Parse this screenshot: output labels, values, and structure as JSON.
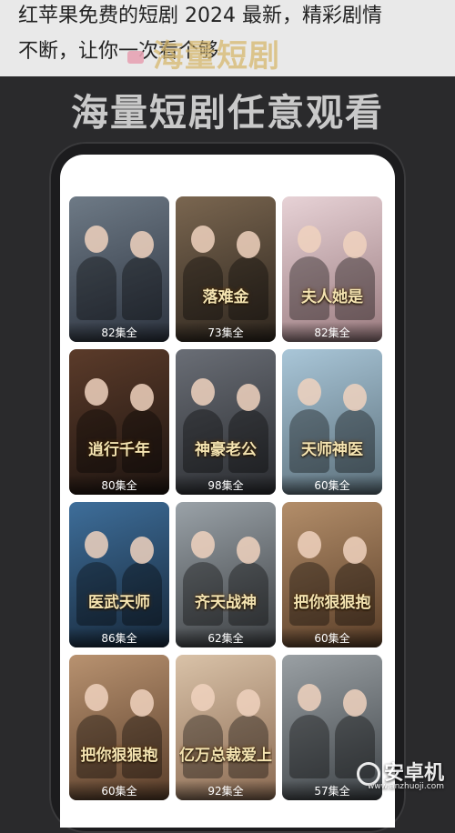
{
  "caption": {
    "line1": "红苹果免费的短剧 2024 最新，精彩剧情",
    "line2": "不断，让你一次看个够"
  },
  "overlay_brand": "海量短剧",
  "headline": "海量短剧任意观看",
  "dramas": [
    {
      "title_art": "",
      "episodes": "82集全",
      "colors": [
        "#6e7a86",
        "#2d3440"
      ]
    },
    {
      "title_art": "落难金",
      "episodes": "73集全",
      "colors": [
        "#7a6650",
        "#2e261e"
      ]
    },
    {
      "title_art": "夫人她是",
      "episodes": "82集全",
      "colors": [
        "#e7d2d6",
        "#9a7b7f"
      ]
    },
    {
      "title_art": "逍行千年",
      "episodes": "80集全",
      "colors": [
        "#5b3b2a",
        "#1d1410"
      ]
    },
    {
      "title_art": "神豪老公",
      "episodes": "98集全",
      "colors": [
        "#6a6e76",
        "#2a2c30"
      ]
    },
    {
      "title_art": "天师神医",
      "episodes": "60集全",
      "colors": [
        "#a9c6d8",
        "#5b6f7a"
      ]
    },
    {
      "title_art": "医武天师",
      "episodes": "86集全",
      "colors": [
        "#3e6e9a",
        "#17283a"
      ]
    },
    {
      "title_art": "齐天战神",
      "episodes": "62集全",
      "colors": [
        "#9aa2a8",
        "#3c3f42"
      ]
    },
    {
      "title_art": "把你狠狠抱",
      "episodes": "60集全",
      "colors": [
        "#b38e6a",
        "#5a3e28"
      ]
    },
    {
      "title_art": "把你狠狠抱",
      "episodes": "60集全",
      "colors": [
        "#b89270",
        "#5a3e2a"
      ]
    },
    {
      "title_art": "亿万总裁爱上我",
      "episodes": "92集全",
      "colors": [
        "#d9c2a8",
        "#8a6a52"
      ]
    },
    {
      "title_art": "",
      "episodes": "57集全",
      "colors": [
        "#9aa0a4",
        "#3f4448"
      ]
    }
  ],
  "watermark": {
    "name": "安卓机",
    "url": "www.anzhuoji.com"
  }
}
